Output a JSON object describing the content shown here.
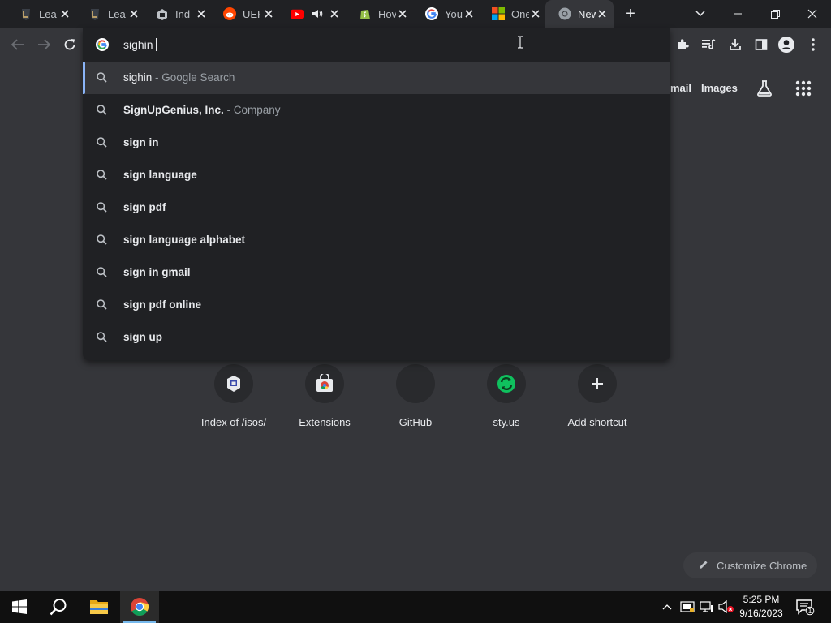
{
  "tabs": [
    {
      "title": "Lea",
      "icon": "league-icon",
      "color": "#c8aa6e"
    },
    {
      "title": "Lea",
      "icon": "league-icon",
      "color": "#c8aa6e"
    },
    {
      "title": "Ind",
      "icon": "folder-index-icon",
      "color": "#9aa0a6"
    },
    {
      "title": "UEF",
      "icon": "reddit-icon",
      "color": "#ff4500"
    },
    {
      "title": "",
      "icon": "youtube-icon",
      "color": "#ff0000",
      "audio": true
    },
    {
      "title": "Hov",
      "icon": "shopify-icon",
      "color": "#95bf47"
    },
    {
      "title": "You",
      "icon": "google-icon",
      "color": "#4285f4"
    },
    {
      "title": "One",
      "icon": "microsoft-icon",
      "color": "#f25022"
    },
    {
      "title": "New",
      "icon": "chrome-icon",
      "color": "#9aa0a6",
      "active": true
    }
  ],
  "omnibox": {
    "value": "sighin",
    "suggestions": [
      {
        "main": "",
        "plain": "sighin",
        "desc": " - Google Search",
        "selected": true
      },
      {
        "main": "SignUpGenius, Inc.",
        "plain": "",
        "desc": " - Company"
      },
      {
        "main": "sign in",
        "plain": "",
        "desc": ""
      },
      {
        "main": "sign language",
        "plain": "",
        "desc": ""
      },
      {
        "main": "sign pdf",
        "plain": "",
        "desc": ""
      },
      {
        "main": "sign language alphabet",
        "plain": "",
        "desc": ""
      },
      {
        "main": "sign in gmail",
        "plain": "",
        "desc": ""
      },
      {
        "main": "sign pdf online",
        "plain": "",
        "desc": ""
      },
      {
        "main": "sign up",
        "plain": "",
        "desc": ""
      }
    ]
  },
  "ntp": {
    "gmail_label": "mail",
    "images_label": "Images",
    "shortcuts": [
      {
        "label": "Index of /isos/",
        "icon": "server-icon"
      },
      {
        "label": "Extensions",
        "icon": "chrome-web-store-icon"
      },
      {
        "label": "GitHub",
        "icon": "github-icon"
      },
      {
        "label": "sty.us",
        "icon": "sty-icon"
      },
      {
        "label": "Add shortcut",
        "icon": "plus-icon"
      }
    ],
    "customize_label": "Customize Chrome"
  },
  "taskbar": {
    "time": "5:25 PM",
    "date": "9/16/2023",
    "notification_count": "1"
  },
  "colors": {
    "accent": "#8ab4f8",
    "bg": "#35363a",
    "tabstrip": "#202124"
  }
}
